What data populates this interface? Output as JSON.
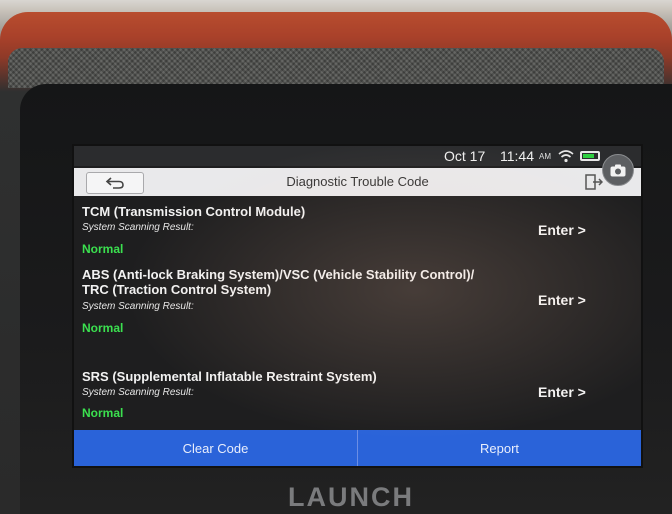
{
  "device": {
    "brand": "LAUNCH"
  },
  "status_bar": {
    "date": "Oct 17",
    "time": "11:44",
    "ampm": "AM"
  },
  "header": {
    "title": "Diagnostic Trouble Code"
  },
  "systems": [
    {
      "name_lines": [
        "TCM (Transmission Control Module)"
      ],
      "scan_label": "System Scanning Result:",
      "status": "Normal",
      "action": "Enter >"
    },
    {
      "name_lines": [
        "ABS (Anti-lock Braking System)/VSC (Vehicle Stability Control)/",
        "TRC (Traction Control System)"
      ],
      "scan_label": "System Scanning Result:",
      "status": "Normal",
      "action": "Enter >"
    },
    {
      "name_lines": [
        "SRS (Supplemental Inflatable Restraint System)"
      ],
      "scan_label": "System Scanning Result:",
      "status": "Normal",
      "action": "Enter >"
    }
  ],
  "footer": {
    "clear_code_label": "Clear Code",
    "report_label": "Report"
  },
  "icons": {
    "back": "back-arrow-icon",
    "exit": "exit-door-icon",
    "camera": "camera-icon",
    "wifi": "wifi-icon",
    "battery": "battery-icon"
  },
  "colors": {
    "accent": "#2a63d9",
    "status_ok": "#3be04f",
    "device_body": "#b84d2f"
  }
}
